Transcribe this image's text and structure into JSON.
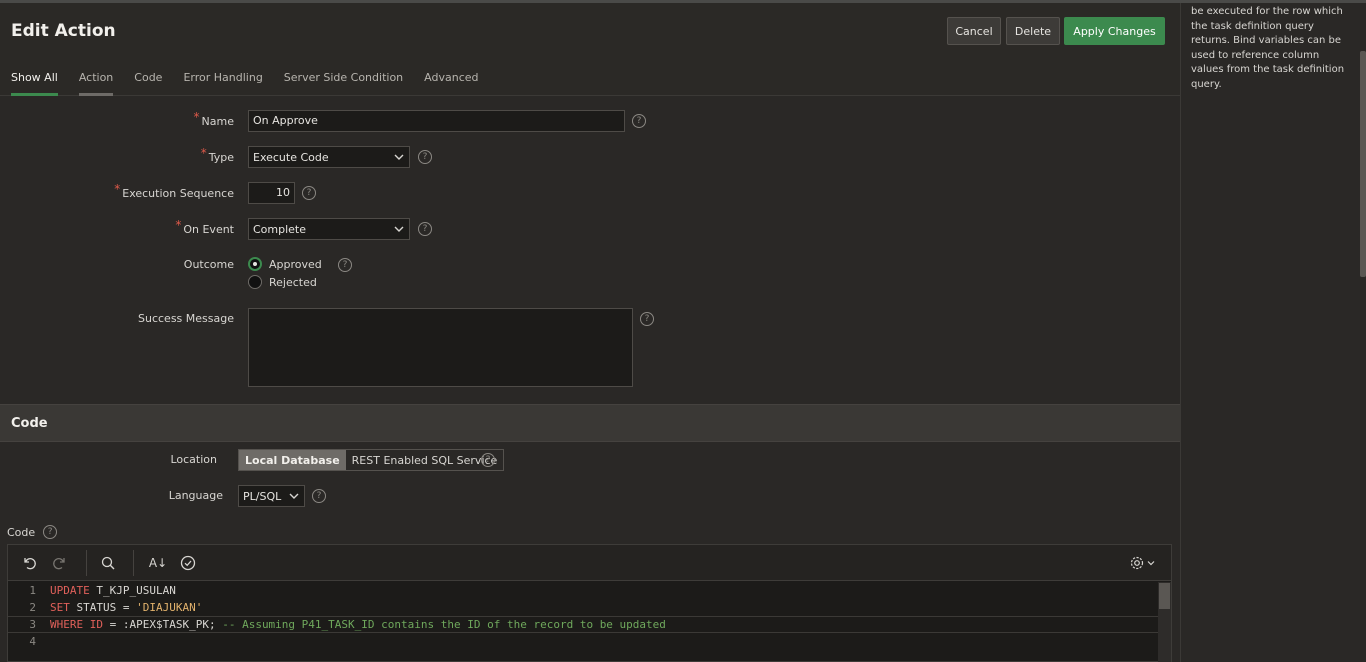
{
  "header": {
    "title": "Edit Action",
    "buttons": {
      "cancel": "Cancel",
      "delete": "Delete",
      "apply": "Apply Changes"
    }
  },
  "tabs": [
    {
      "label": "Show All",
      "active": true
    },
    {
      "label": "Action",
      "active": false
    },
    {
      "label": "Code",
      "active": false
    },
    {
      "label": "Error Handling",
      "active": false
    },
    {
      "label": "Server Side Condition",
      "active": false
    },
    {
      "label": "Advanced",
      "active": false
    }
  ],
  "form": {
    "required_mark": "*",
    "help_glyph": "?",
    "name": {
      "label": "Name",
      "value": "On Approve"
    },
    "type": {
      "label": "Type",
      "value": "Execute Code"
    },
    "execution_sequence": {
      "label": "Execution Sequence",
      "value": "10"
    },
    "on_event": {
      "label": "On Event",
      "value": "Complete"
    },
    "outcome": {
      "label": "Outcome",
      "options": [
        "Approved",
        "Rejected"
      ],
      "selected": "Approved"
    },
    "success_message": {
      "label": "Success Message",
      "value": ""
    }
  },
  "code_section": {
    "title": "Code",
    "location": {
      "label": "Location",
      "options": [
        "Local Database",
        "REST Enabled SQL Service"
      ],
      "selected": "Local Database"
    },
    "language": {
      "label": "Language",
      "value": "PL/SQL"
    },
    "code_label": "Code",
    "toolbar": {
      "undo": "undo-icon",
      "redo": "redo-icon",
      "search": "search-icon",
      "transform": "A↓",
      "validate": "check-circle-icon",
      "settings": "gear-icon"
    },
    "lines": [
      {
        "n": "1",
        "kw": "UPDATE",
        "rest": " T_KJP_USULAN"
      },
      {
        "n": "2",
        "kw": "SET",
        "rest": " STATUS = ",
        "str": "'DIAJUKAN'"
      },
      {
        "n": "3",
        "kw": "WHERE ID",
        "rest": " = :APEX$TASK_PK; ",
        "comment": "-- Assuming P41_TASK_ID contains the ID of the record to be updated"
      },
      {
        "n": "4"
      }
    ]
  },
  "help_panel": {
    "text": "be executed for the row which the task definition query returns. Bind variables can be used to reference column values from the task definition query."
  },
  "colors": {
    "accent": "#3c8a4e",
    "required": "#e05a4a",
    "keyword": "#e0605a",
    "string": "#e2b26c",
    "comment": "#6fa85c"
  }
}
